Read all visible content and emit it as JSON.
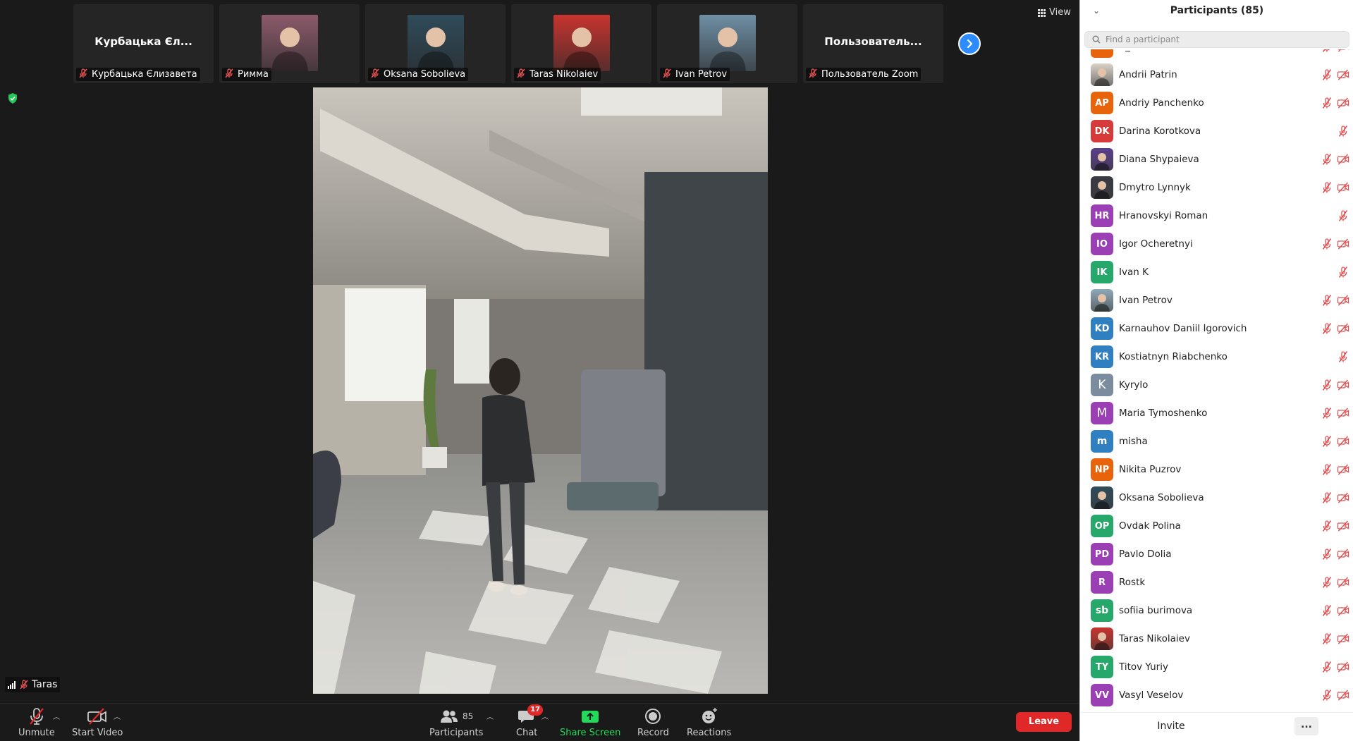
{
  "view_label": "View",
  "gallery": [
    {
      "display": "Курбацька Єл...",
      "label": "Курбацька Єлизавета",
      "has_photo": false
    },
    {
      "display": "",
      "label": "Римма",
      "has_photo": true,
      "photo_color": "#8c5a6a"
    },
    {
      "display": "",
      "label": "Oksana Sobolieva",
      "has_photo": true,
      "photo_color": "#2f4b5a"
    },
    {
      "display": "",
      "label": "Taras Nikolaiev",
      "has_photo": true,
      "photo_color": "#c8342f"
    },
    {
      "display": "",
      "label": "Ivan Petrov",
      "has_photo": true,
      "photo_color": "#6f8fa6"
    },
    {
      "display": "Пользователь...",
      "label": "Пользователь Zoom",
      "has_photo": false
    }
  ],
  "active_speaker": "Taras",
  "toolbar": {
    "unmute": "Unmute",
    "start_video": "Start Video",
    "participants": "Participants",
    "participants_count": "85",
    "chat": "Chat",
    "chat_badge": "17",
    "share_screen": "Share Screen",
    "record": "Record",
    "reactions": "Reactions",
    "leave": "Leave"
  },
  "panel": {
    "title": "Participants (85)",
    "search_placeholder": "Find a participant",
    "invite": "Invite",
    "more": "..."
  },
  "participants": [
    {
      "initials": "A",
      "name": "A_V",
      "color": "#e8640c",
      "video_icon": true
    },
    {
      "initials": "",
      "name": "Andrii Patrin",
      "color": "#d9d2c8",
      "photo": true,
      "video_icon": true
    },
    {
      "initials": "AP",
      "name": "Andriy Panchenko",
      "color": "#e8640c",
      "video_icon": true
    },
    {
      "initials": "DK",
      "name": "Darina Korotkova",
      "color": "#d63a3a",
      "video_icon": false
    },
    {
      "initials": "",
      "name": "Diana Shypaieva",
      "color": "#5a3f8c",
      "photo": true,
      "video_icon": true
    },
    {
      "initials": "",
      "name": "Dmytro Lynnyk",
      "color": "#3a3a44",
      "photo": true,
      "video_icon": true
    },
    {
      "initials": "HR",
      "name": "Hranovskyi Roman",
      "color": "#9b3fb5",
      "video_icon": false
    },
    {
      "initials": "IO",
      "name": "Igor Ocheretnyi",
      "color": "#9b3fb5",
      "video_icon": true
    },
    {
      "initials": "IK",
      "name": "Ivan K",
      "color": "#27a86a",
      "video_icon": false
    },
    {
      "initials": "",
      "name": "Ivan Petrov",
      "color": "#8fa8b8",
      "photo": true,
      "video_icon": true
    },
    {
      "initials": "KD",
      "name": "Karnauhov Daniil Igorovich",
      "color": "#2f7fc1",
      "video_icon": true
    },
    {
      "initials": "KR",
      "name": "Kostiatnyn Riabchenko",
      "color": "#2f7fc1",
      "video_icon": false
    },
    {
      "initials": "K",
      "name": "Kyrylo",
      "color": "#7a8c9e",
      "single": true,
      "video_icon": true
    },
    {
      "initials": "M",
      "name": "Maria Tymoshenko",
      "color": "#9b3fb5",
      "single": true,
      "video_icon": true
    },
    {
      "initials": "m",
      "name": "misha",
      "color": "#2f7fc1",
      "lower": true,
      "video_icon": true
    },
    {
      "initials": "NP",
      "name": "Nikita Puzrov",
      "color": "#e8640c",
      "video_icon": true
    },
    {
      "initials": "",
      "name": "Oksana Sobolieva",
      "color": "#2f4b5a",
      "photo": true,
      "video_icon": true
    },
    {
      "initials": "OP",
      "name": "Ovdak Polina",
      "color": "#27a86a",
      "video_icon": true
    },
    {
      "initials": "PD",
      "name": "Pavlo Dolia",
      "color": "#9b3fb5",
      "video_icon": true
    },
    {
      "initials": "R",
      "name": "Rostk",
      "color": "#9b3fb5",
      "video_icon": true
    },
    {
      "initials": "sb",
      "name": "sofiia burimova",
      "color": "#27a86a",
      "lower": true,
      "video_icon": true
    },
    {
      "initials": "",
      "name": "Taras Nikolaiev",
      "color": "#c8342f",
      "photo": true,
      "video_icon": true
    },
    {
      "initials": "TY",
      "name": "Titov Yuriy",
      "color": "#27a86a",
      "video_icon": true
    },
    {
      "initials": "VV",
      "name": "Vasyl Veselov",
      "color": "#9b3fb5",
      "video_icon": true
    }
  ],
  "colors": {
    "accent_blue": "#2d8cff",
    "leave_red": "#e02828",
    "share_green": "#23d959",
    "muted_red": "#e05050"
  }
}
